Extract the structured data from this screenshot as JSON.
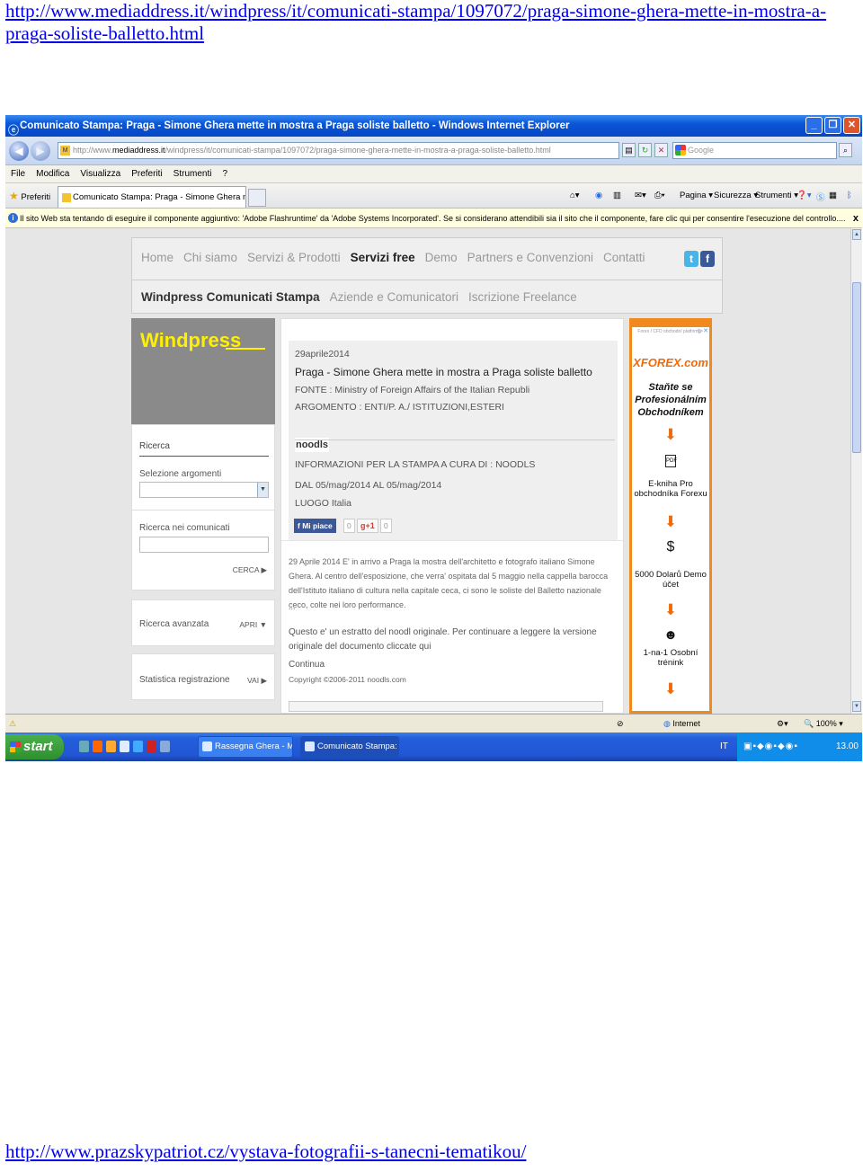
{
  "pdf": {
    "top_link": "http://www.mediaddress.it/windpress/it/comunicati-stampa/1097072/praga-simone-ghera-mette-in-mostra-a-praga-soliste-balletto.html",
    "bottom_link": "http://www.prazskypatriot.cz/vystava-fotografii-s-tanecni-tematikou/"
  },
  "browser": {
    "title": "Comunicato Stampa: Praga - Simone Ghera mette in mostra a Praga soliste balletto - Windows Internet Explorer",
    "url_prefix": "http://www.",
    "url_domain": "mediaddress.it",
    "url_rest": "/windpress/it/comunicati-stampa/1097072/praga-simone-ghera-mette-in-mostra-a-praga-soliste-balletto.html",
    "search_placeholder": "Google",
    "menu": [
      "File",
      "Modifica",
      "Visualizza",
      "Preferiti",
      "Strumenti",
      "?"
    ],
    "favorites_label": "Preferiti",
    "tab_title": "Comunicato Stampa: Praga - Simone Ghera mette in m...",
    "commands": {
      "page": "Pagina",
      "security": "Sicurezza",
      "tools": "Strumenti"
    },
    "infobar": "Il sito Web sta tentando di eseguire il componente aggiuntivo: 'Adobe Flashruntime' da 'Adobe Systems Incorporated'. Se si considerano attendibili sia il sito che il componente, fare clic qui per consentire l'esecuzione del controllo....",
    "infobar_close": "x",
    "status_zone": "Internet",
    "zoom": "100%"
  },
  "site": {
    "nav_primary": [
      "Home",
      "Chi siamo",
      "Servizi & Prodotti",
      "Servizi free",
      "Demo",
      "Partners e Convenzioni",
      "Contatti"
    ],
    "nav_secondary": [
      "Windpress Comunicati Stampa",
      "Aziende e Comunicatori",
      "Iscrizione Freelance"
    ],
    "brand": "Windpress",
    "sidebar": {
      "search_title": "Ricerca",
      "topics_label": "Selezione argomenti",
      "search_label": "Ricerca nei comunicati",
      "search_button": "CERCA",
      "advanced_label": "Ricerca avanzata",
      "advanced_button": "APRI",
      "stats_label": "Statistica registrazione",
      "stats_button": "VAI"
    },
    "article": {
      "date": "29aprile2014",
      "title": "Praga - Simone Ghera mette in mostra a Praga soliste balletto",
      "source": "FONTE : Ministry of Foreign Affairs of the Italian Republi",
      "topic": "ARGOMENTO : ENTI/P. A./ ISTITUZIONI,ESTERI",
      "noodls": "noodls",
      "info": "INFORMAZIONI PER LA STAMPA A CURA DI : NOODLS",
      "dates": "DAL 05/mag/2014 AL 05/mag/2014",
      "place": "LUOGO Italia",
      "like_label": "Mi piace",
      "like_count": "0",
      "gplus_label": "g+1",
      "gplus_count": "0",
      "body": "29 Aprile 2014 E' in arrivo a Praga la mostra dell'architetto e fotografo italiano Simone Ghera. Al centro dell'esposizione, che verra' ospitata dal 5 maggio nella cappella barocca dell'Istituto italiano di cultura nella capitale ceca, ci sono le soliste del Balletto nazionale ceco, colte nei loro performance.",
      "ellipsis": "...",
      "excerpt": "Questo e' un estratto del noodl originale. Per continuare a leggere la versione originale del documento cliccate qui",
      "continue": "Continua",
      "copyright": "Copyright ©2006-2011 noodls.com"
    },
    "ad": {
      "tiny": "Forex / CFD obchodní platformy",
      "logo": "XFOREX.com",
      "claim": "Staňte se Profesionálním Obchodníkem",
      "pdf_icon": "PDF",
      "item1": "E-kniha Pro obchodníka Forexu",
      "item2": "5000 Dolarů Demo účet",
      "item3": "1-na-1 Osobní trénink"
    }
  },
  "taskbar": {
    "start": "start",
    "tasks": [
      "Rassegna Ghera - Mic...",
      "Comunicato Stampa: ..."
    ],
    "lang": "IT",
    "clock": "13.00"
  }
}
